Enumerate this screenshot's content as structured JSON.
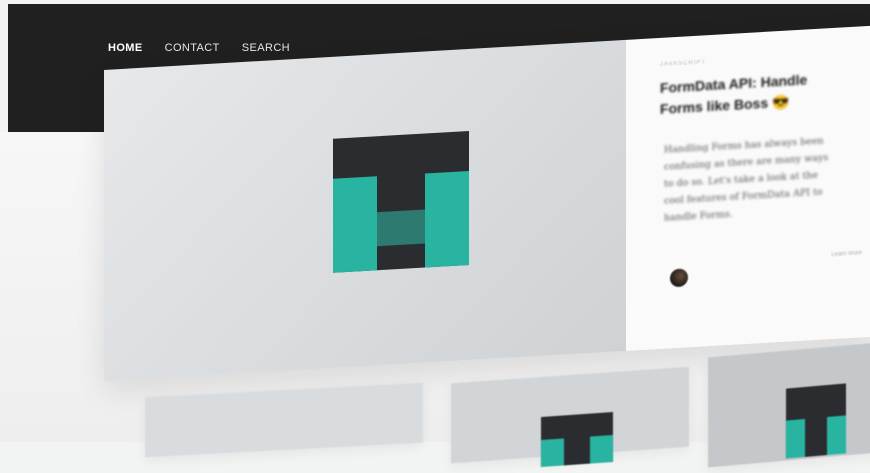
{
  "nav": {
    "items": [
      "HOME",
      "CONTACT",
      "SEARCH"
    ],
    "active_index": 0
  },
  "social": {
    "icons": [
      "rss-icon",
      "github-icon",
      "twitter-icon"
    ]
  },
  "featured_post": {
    "category": "JAVASCRIPT",
    "title": "FormData API: Handle Forms like Boss 😎",
    "excerpt": "Handling Forms has always been confusing as there are many ways to do so. Let's take a look at the cool features of FormData API to handle Forms.",
    "read_more": "Learn More"
  },
  "colors": {
    "topbar": "#202020",
    "accent": "#29b4a2",
    "logo_dark": "#2b2c2f"
  }
}
